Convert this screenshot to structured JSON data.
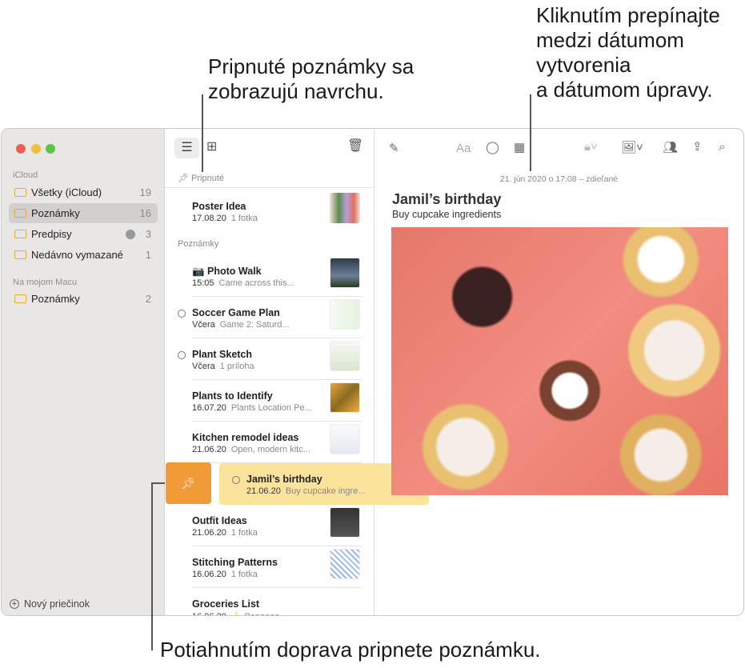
{
  "callouts": {
    "pinned": "Pripnuté poznámky sa\nzobrazujú navrchu.",
    "date": "Kliknutím prepínajte\nmedzi dátumom\nvytvorenia\na dátumom úpravy.",
    "swipe": "Potiahnutím doprava pripnete poznámku."
  },
  "sidebar": {
    "icloud_label": "iCloud",
    "mac_label": "Na mojom Macu",
    "items": [
      {
        "label": "Všetky (iCloud)",
        "count": "19"
      },
      {
        "label": "Poznámky",
        "count": "16"
      },
      {
        "label": "Predpisy",
        "count": "3"
      },
      {
        "label": "Nedávno vymazané",
        "count": "1"
      }
    ],
    "mac_items": [
      {
        "label": "Poznámky",
        "count": "2"
      }
    ],
    "new_folder": "Nový priečinok"
  },
  "list": {
    "pinned_label": "Pripnuté",
    "notes_label": "Poznámky",
    "pinned": [
      {
        "title": "Poster Idea",
        "date": "17.08.20",
        "preview": "1 fotka"
      }
    ],
    "notes": [
      {
        "title": "📷 Photo Walk",
        "date": "15:05",
        "preview": "Came across this..."
      },
      {
        "title": "Soccer Game Plan",
        "date": "Včera",
        "preview": "Game 2: Saturd...",
        "shared": true
      },
      {
        "title": "Plant Sketch",
        "date": "Včera",
        "preview": "1 príloha",
        "shared": true
      },
      {
        "title": "Plants to Identify",
        "date": "16.07.20",
        "preview": "Plants Location Pe..."
      },
      {
        "title": "Kitchen remodel ideas",
        "date": "21.06.20",
        "preview": "Open, modern kitc..."
      },
      {
        "title": "Jamil’s birthday",
        "date": "21.06.20",
        "preview": "Buy cupcake ingre...",
        "shared": true,
        "selected": true
      },
      {
        "title": "Outfit Ideas",
        "date": "21.06.20",
        "preview": "1 fotka"
      },
      {
        "title": "Stitching Patterns",
        "date": "16.06.20",
        "preview": "1 fotka"
      },
      {
        "title": "Groceries List",
        "date": "16.06.20",
        "preview": "🍌 Bananas"
      }
    ]
  },
  "editor": {
    "date": "21. jún 2020 o 17:08 – zdieľané",
    "title": "Jamil’s birthday",
    "body": "Buy cupcake ingredients",
    "format_label": "Aa"
  },
  "colors": {
    "accent": "#f09a38",
    "selected_row": "#fbe39b",
    "folder": "#e9a93a"
  }
}
